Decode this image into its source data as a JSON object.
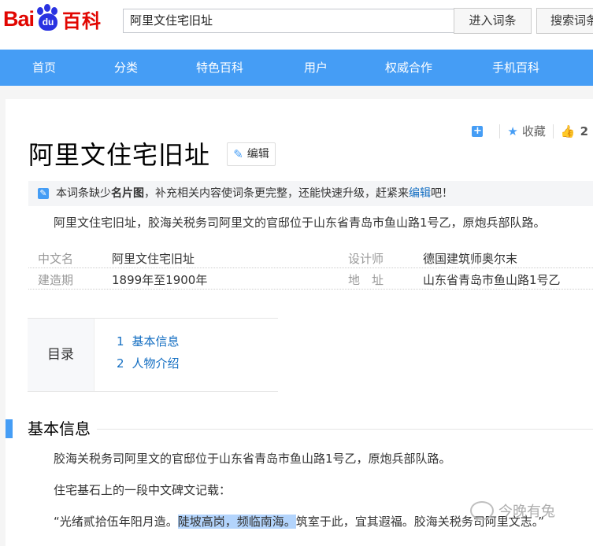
{
  "header": {
    "logo_bai": "Bai",
    "logo_du": "du",
    "logo_baike": "百科",
    "search_value": "阿里文住宅旧址",
    "enter_button": "进入词条",
    "search_button": "搜索词条"
  },
  "nav": {
    "items": [
      "首页",
      "分类",
      "特色百科",
      "用户",
      "权威合作",
      "手机百科"
    ]
  },
  "tools": {
    "favorite_label": "收藏",
    "like_count": "2"
  },
  "entry": {
    "title": "阿里文住宅旧址",
    "edit_label": "编辑"
  },
  "notice": {
    "prefix": "本词条缺少",
    "bold": "名片图",
    "middle": "，补充相关内容使词条更完整，还能快速升级，赶紧来",
    "link": "编辑",
    "suffix": "吧！"
  },
  "summary": "阿里文住宅旧址，胶海关税务司阿里文的官邸位于山东省青岛市鱼山路1号乙，原炮兵部队路。",
  "basic_info": {
    "left": [
      {
        "key": "中文名",
        "value": "阿里文住宅旧址"
      },
      {
        "key": "建造期",
        "value": "1899年至1900年"
      }
    ],
    "right": [
      {
        "key": "设计师",
        "value": "德国建筑师奥尔末"
      },
      {
        "key": "地　址",
        "value": "山东省青岛市鱼山路1号乙"
      }
    ]
  },
  "catalog": {
    "label": "目录",
    "items": [
      {
        "num": "1",
        "text": "基本信息"
      },
      {
        "num": "2",
        "text": "人物介绍"
      }
    ]
  },
  "section": {
    "title": "基本信息",
    "para1": "胶海关税务司阿里文的官邸位于山东省青岛市鱼山路1号乙，原炮兵部队路。",
    "para2": "住宅基石上的一段中文碑文记载：",
    "para3_a": "“光绪贰拾伍年阳月造。",
    "para3_hl": "陡坡高岗，频临南海。",
    "para3_b": "筑室于此，宜其遐福。胶海关税务司阿里文志。”"
  },
  "watermark": {
    "text": "今晚有兔"
  }
}
